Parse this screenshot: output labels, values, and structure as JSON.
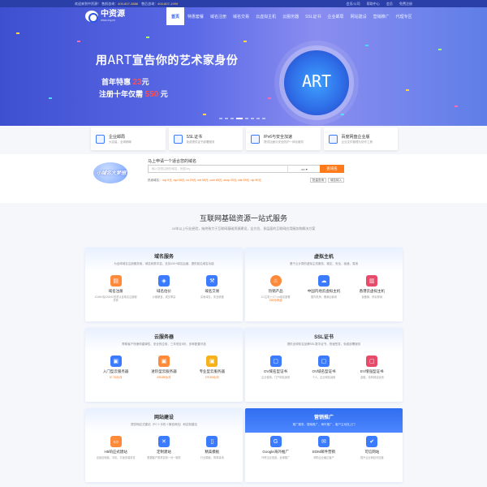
{
  "topbar": {
    "welcome": "欢迎来到中资源！",
    "sales_label": "售前咨询：",
    "sales_phone": "400-807-3886",
    "service_label": "售后咨询：",
    "service_phone": "400-807-1999",
    "links": [
      "会员/公司",
      "帮助中心",
      "会员",
      "免费注册"
    ]
  },
  "logo": {
    "name": "中资源",
    "url_text": "www.zzy.cn"
  },
  "nav": [
    "首页",
    "特惠套餐",
    "域名注册",
    "域名交易",
    "云虚拟主机",
    "云服务器",
    "SSL证书",
    "企业邮局",
    "网站建设",
    "营销推广",
    "代理专区"
  ],
  "hero": {
    "headline_pre": "用",
    "headline_art": "ART",
    "headline_post": "宣告你的艺术家身份",
    "promo1_text": "首年特惠",
    "promo1_price": "23",
    "promo1_unit": "元",
    "promo2_text": "注册十年仅需",
    "promo2_price": "550",
    "promo2_unit": "元",
    "badge": "ART"
  },
  "features": [
    {
      "title": "企业邮局",
      "sub": "大容量，全球畅邮"
    },
    {
      "title": "SSL证书",
      "sub": "免费提供证书部署服务"
    },
    {
      "title": "IPv6与安全加速",
      "sub": "提供加速与安全防护一体化服务"
    },
    {
      "title": "百度网盘企业版",
      "sub": "企业文件管理与协作工具"
    }
  ],
  "domain_search": {
    "mascot": "小域名大梦想",
    "title": "马上申请一个适合您的域名",
    "placeholder": "输入您想注册的域名，例如zzy",
    "ext": ".cn",
    "button": "查域名",
    "hot_label": "热卖域名：",
    "hot_text": ".top 9元  .xyz 18元  .cn 29元  .net 55元  .com 65元  .shop 30元  .site 15元  .vip 50元",
    "btn_batch": "批量查询",
    "btn_transfer": "域名转入"
  },
  "intro": {
    "title": "互联网基础资源一站式服务",
    "sub": "24年以上行业经验，始终致力于互联网基础资源建设，全方位、多层面的互联网应用服务和解决方案"
  },
  "cards": [
    {
      "title": "域名服务",
      "sub": "为全球域名注册服务商，域名种类丰富，支持100+域名后缀，提供前沿域名功能",
      "items": [
        {
          "name": "域名注册",
          "desc": "ICANN及CNNIC双重认证域名注册服务商",
          "color": "#ff8a3a"
        },
        {
          "name": "域名估价",
          "desc": "价格便宜，成交率高",
          "color": "#3a7bff"
        },
        {
          "name": "域名交易",
          "desc": "买卖域名，安全便捷",
          "color": "#3a7bff"
        }
      ]
    },
    {
      "title": "虚拟主机",
      "sub": "基于云计算的虚拟主机服务，稳定，安全，极速，易用",
      "items": [
        {
          "name": "热销产品",
          "desc": "1G主机＋1个.cn域名套餐",
          "price": "218元/年起",
          "color": "#ff8a3a"
        },
        {
          "name": "中国内地云虚拟主机",
          "desc": "国内机房，备案后使用",
          "color": "#3a7bff"
        },
        {
          "name": "香港云虚拟主机",
          "desc": "免备案，即买即用",
          "color": "#e84a6a"
        }
      ]
    },
    {
      "title": "云服务器",
      "sub": "帮助客户快速构建弹性、安全的应用，三年低至5折，多种配置可选",
      "items": [
        {
          "name": "入门型云服务器",
          "price": "67.76元/月",
          "color": "#3a7bff"
        },
        {
          "name": "进阶型云服务器",
          "price": "320.55元/月",
          "color": "#ff8a3a"
        },
        {
          "name": "专业型云服务器",
          "price": "275.60元/月",
          "color": "#f5b21a"
        }
      ]
    },
    {
      "title": "SSL证书",
      "sub": "提供全球知名品牌SSL数字证书，快速签发，免费部署服务",
      "items": [
        {
          "name": "DV域名型证书",
          "desc": "企业使用，门户网站适用",
          "color": "#3a7bff"
        },
        {
          "name": "OV域名型证书",
          "desc": "个人，企业网站适用",
          "color": "#3a7bff"
        },
        {
          "name": "EV增强型证书",
          "desc": "金融，电商网站适用",
          "color": "#e84a6a"
        }
      ]
    },
    {
      "title": "网站建设",
      "sub": "提供响应式建站（PC＋手机＋微信网站）和定制建站",
      "items": [
        {
          "name": "H5响应式建站",
          "desc": "自适应电脑、手机、平板多端浏览",
          "color": "#ff8a3a"
        },
        {
          "name": "定制建站",
          "desc": "根据客户需求定制一对一服务",
          "color": "#3a7bff"
        },
        {
          "name": "精美模板",
          "desc": "行业模板，简单易用",
          "color": "#3a7bff"
        }
      ]
    },
    {
      "title": "营销推广",
      "sub": "推广服务，搜索推广，海外推广，客户主动找上门",
      "items": [
        {
          "name": "Google海外推广",
          "desc": "外贸企业首选，全球推广",
          "color": "#3a7bff"
        },
        {
          "name": "EDM邮件营销",
          "desc": "帮助企业触达客户",
          "color": "#3a7bff"
        },
        {
          "name": "可信网站",
          "desc": "提升企业网站可信度",
          "color": "#3a7bff"
        }
      ]
    }
  ]
}
